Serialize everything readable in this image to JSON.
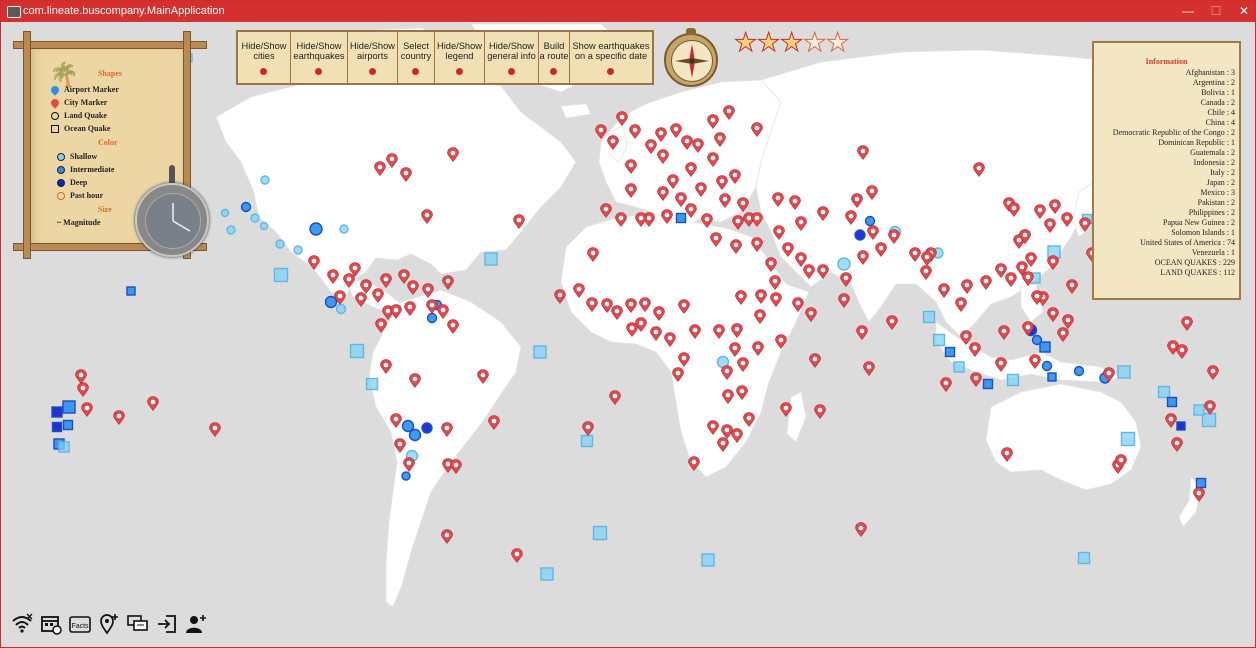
{
  "window": {
    "title": "com.lineate.buscompany.MainApplication",
    "minimize_glyph": "—",
    "maximize_glyph": "☐",
    "close_glyph": "✕"
  },
  "legend": {
    "shapes_title": "Shapes",
    "airport_marker": "Airport Marker",
    "city_marker": "City Marker",
    "land_quake": "Land Quake",
    "ocean_quake": "Ocean Quake",
    "color_title": "Color",
    "shallow": "Shallow",
    "intermediate": "Intermediate",
    "deep": "Deep",
    "past_hour": "Past hour",
    "size_title": "Size",
    "magnitude": "~ Magnitude"
  },
  "toolbar": {
    "buttons": [
      "Hide/Show\ncities",
      "Hide/Show\nearthquakes",
      "Hide/Show\nairports",
      "Select\ncountry",
      "Hide/Show\nlegend",
      "Hide/Show\ngeneral info",
      "Build\na route",
      "Show earthquakes\non a specific date"
    ]
  },
  "rating": {
    "filled": 3,
    "total": 5
  },
  "info": {
    "title": "Information",
    "rows": [
      "Afghanistan : 3",
      "Argentina : 2",
      "Bolivia : 1",
      "Canada : 2",
      "Chile : 4",
      "China : 4",
      "Democratic Republic of the Congo : 2",
      "Dominican Republic : 1",
      "Guatemala : 2",
      "Indonesia : 2",
      "Italy : 2",
      "Japan : 2",
      "Mexico : 3",
      "Pakistan : 2",
      "Philippines : 2",
      "Papua New Guinea : 2",
      "Solomon Islands : 1",
      "United States of America : 74",
      "Venezuela : 1",
      "OCEAN QUAKES : 229",
      "LAND QUAKES : 112"
    ]
  },
  "colors": {
    "titlebar": "#d3302f",
    "city_marker": "#e04a4f",
    "shallow": "#7fd3f5",
    "intermediate": "#2a8ff0",
    "deep": "#0b1fd6",
    "land": "#ffffff",
    "ocean": "#dcdcdc"
  },
  "bottom_icons": [
    "wifi-off-icon",
    "calendar-icon",
    "facts-icon",
    "add-location-icon",
    "chat-icon",
    "login-icon",
    "add-user-icon"
  ],
  "bottom_icon_labels": {
    "facts": "Facts"
  }
}
